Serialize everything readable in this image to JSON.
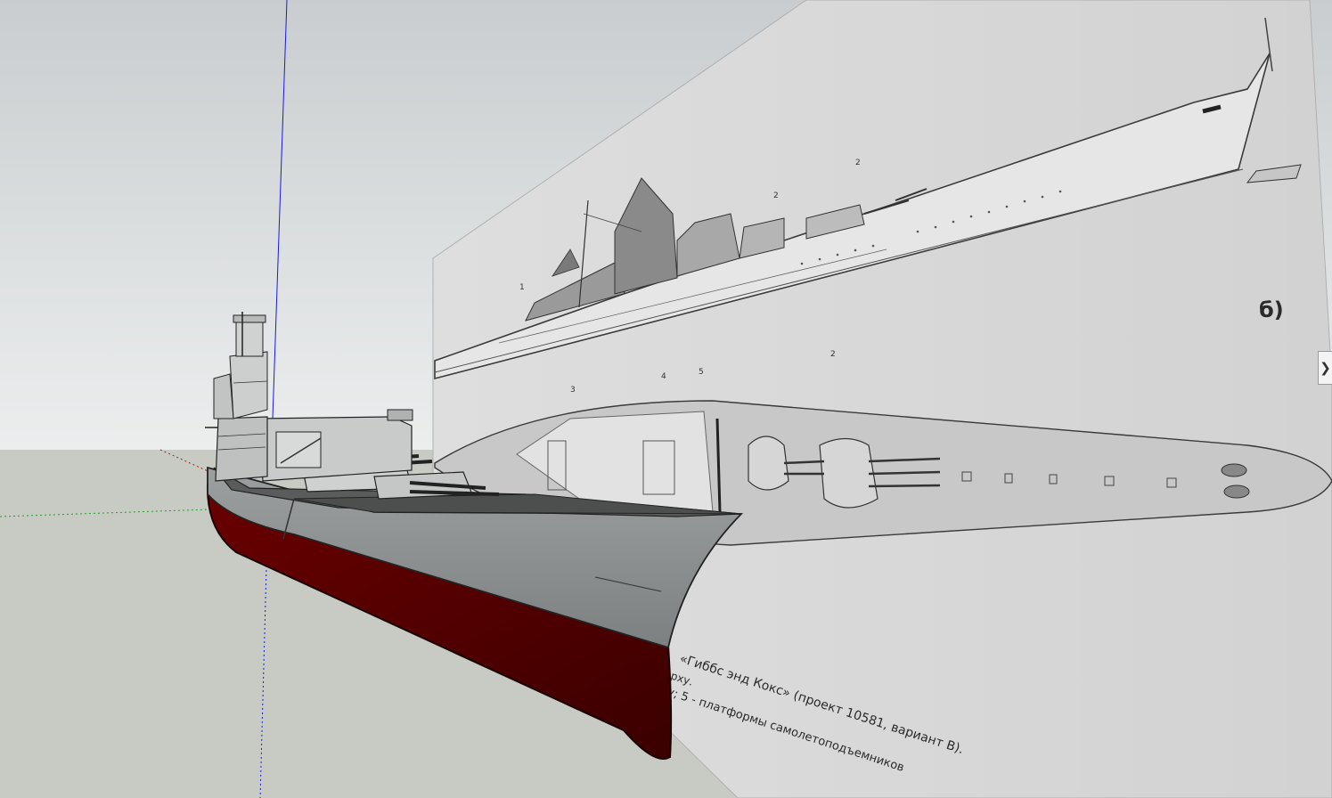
{
  "viewport": {
    "sky_top_color": "#c9cdcf",
    "sky_bottom_color": "#e9ecec",
    "ground_color": "#c8cac4",
    "axis_blue": "#1a1ae0",
    "axis_red": "#d01010",
    "axis_green": "#20a020"
  },
  "reference_image": {
    "panel_label": "б)",
    "callouts": [
      "1",
      "2",
      "2",
      "3",
      "4",
      "5",
      "2"
    ],
    "caption_lines": [
      "«Гиббс энд Кокс» (проект 10581, вариант В).",
      "рху.",
      "у; 5 - платформы самолетоподъемников"
    ]
  },
  "ship_model": {
    "hull_color": "#8a8d8e",
    "deck_color": "#5a5c5c",
    "boot_color": "#5a0000",
    "superstructure_color": "#c9cbcb"
  },
  "side_panel": {
    "toggle_glyph": "❯"
  }
}
